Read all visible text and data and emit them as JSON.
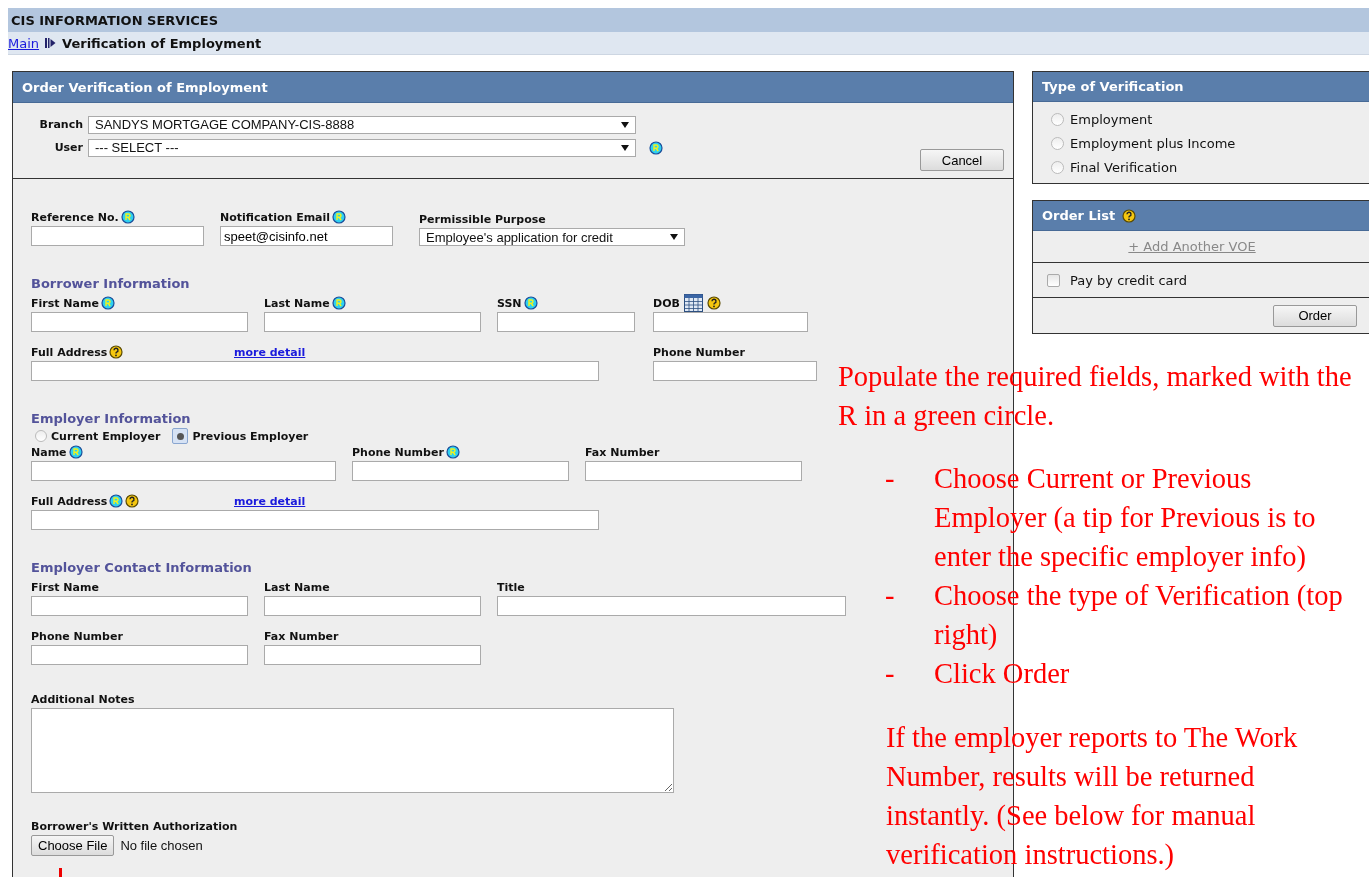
{
  "app_title": "CIS INFORMATION SERVICES",
  "breadcrumb": {
    "link": "Main",
    "current": "Verification of Employment"
  },
  "order_form": {
    "title": "Order Verification of Employment",
    "branch": {
      "label": "Branch",
      "value": "SANDYS MORTGAGE COMPANY-CIS-8888"
    },
    "user": {
      "label": "User",
      "value": "--- SELECT ---",
      "required": true
    },
    "cancel_button": "Cancel",
    "top_fields": [
      {
        "label": "Reference No.",
        "kind": "text",
        "required": true
      },
      {
        "label": "Notification Email",
        "kind": "text",
        "value": "speet@cisinfo.net",
        "required": true
      },
      {
        "label": "Permissible Purpose",
        "kind": "select",
        "value": "Employee's application for credit"
      }
    ],
    "sections": [
      {
        "title": "Borrower Information",
        "rows": [
          {
            "fields": [
              {
                "label": "First Name",
                "kind": "text",
                "required": true
              },
              {
                "label": "Last Name",
                "kind": "text",
                "required": true
              },
              {
                "label": "SSN",
                "kind": "text",
                "required": true
              },
              {
                "label": "DOB",
                "kind": "text",
                "calendar": true,
                "help": true
              }
            ]
          },
          {
            "fields": [
              {
                "label": "Full Address",
                "kind": "text",
                "help": true,
                "link": "more detail"
              },
              {
                "label": "Phone Number",
                "kind": "text"
              }
            ]
          }
        ]
      },
      {
        "title": "Employer Information",
        "options": [
          {
            "label": "Current Employer",
            "selected": false
          },
          {
            "label": "Previous Employer",
            "selected": true
          }
        ],
        "rows": [
          {
            "fields": [
              {
                "label": "Name",
                "kind": "text",
                "required": true
              },
              {
                "label": "Phone Number",
                "kind": "text",
                "required": true
              },
              {
                "label": "Fax Number",
                "kind": "text"
              }
            ]
          },
          {
            "fields": [
              {
                "label": "Full Address",
                "kind": "text",
                "required": true,
                "help": true,
                "link": "more detail"
              }
            ]
          }
        ]
      },
      {
        "title": "Employer Contact Information",
        "rows": [
          {
            "fields": [
              {
                "label": "First Name",
                "kind": "text"
              },
              {
                "label": "Last Name",
                "kind": "text"
              },
              {
                "label": "Title",
                "kind": "text"
              }
            ]
          },
          {
            "fields": [
              {
                "label": "Phone Number",
                "kind": "text"
              },
              {
                "label": "Fax Number",
                "kind": "text"
              }
            ]
          }
        ]
      }
    ],
    "notes": {
      "label": "Additional Notes"
    },
    "attachment": {
      "label": "Borrower's Written Authorization",
      "button": "Choose File",
      "status": "No file chosen"
    }
  },
  "verification_type": {
    "title": "Type of Verification",
    "options": [
      {
        "label": "Employment",
        "selected": false
      },
      {
        "label": "Employment plus Income",
        "selected": false
      },
      {
        "label": "Final Verification",
        "selected": false
      }
    ]
  },
  "order_list": {
    "title": "Order List",
    "help": true,
    "add_link": "+ Add Another VOE",
    "pay_by_card": {
      "label": "Pay by credit card",
      "checked": false
    },
    "order_button": "Order"
  },
  "annotation": {
    "intro": "Populate the required fields, marked with the R in a green circle.",
    "steps": [
      {
        "bullet": "-",
        "text": "Choose Current or Previous Employer (a tip for Previous is to enter the specific employer info)"
      },
      {
        "bullet": "-",
        "text": "Choose the type of Verification (top right)"
      },
      {
        "bullet": "-",
        "text": "Click Order"
      }
    ],
    "note": "If the employer reports to The Work Number, results will be returned instantly. (See below for manual verification instructions.)"
  }
}
